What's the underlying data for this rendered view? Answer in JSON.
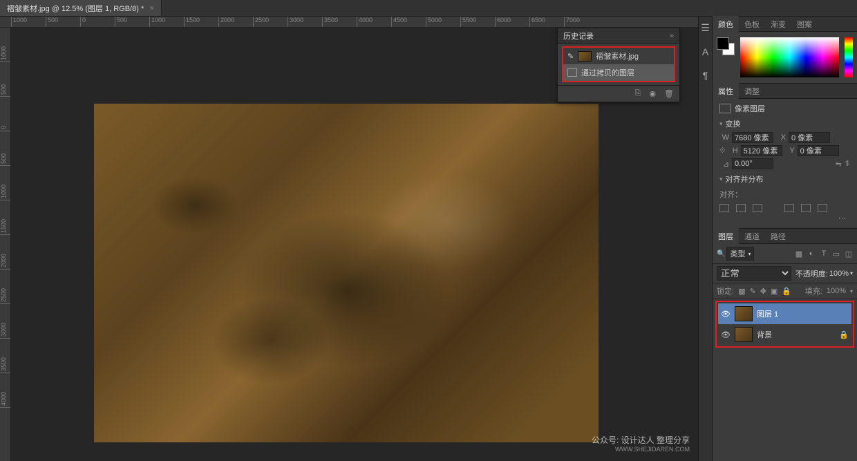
{
  "tab": {
    "title": "褶皱素材.jpg @ 12.5% (图层 1, RGB/8) *"
  },
  "ruler_h": [
    "1000",
    "500",
    "0",
    "500",
    "1000",
    "1500",
    "2000",
    "2500",
    "3000",
    "3500",
    "4000",
    "4500",
    "5000",
    "5500",
    "6000",
    "6500",
    "7000"
  ],
  "ruler_v": [
    "1000",
    "500",
    "0",
    "500",
    "1000",
    "1500",
    "2000",
    "2500",
    "3000",
    "3500",
    "4000"
  ],
  "history": {
    "title": "历史记录",
    "items": [
      {
        "label": "褶皱素材.jpg",
        "type": "open"
      },
      {
        "label": "通过拷贝的图层",
        "type": "action"
      }
    ]
  },
  "color": {
    "tabs": [
      "颜色",
      "色板",
      "渐变",
      "图案"
    ],
    "active": 0
  },
  "properties": {
    "tabs": [
      "属性",
      "调整"
    ],
    "active": 0,
    "kind": "像素图层",
    "transform_hdr": "变换",
    "W": "7680 像素",
    "X": "0 像素",
    "H": "5120 像素",
    "Y": "0 像素",
    "angle": "0.00°",
    "align_hdr": "对齐并分布",
    "align_lbl": "对齐："
  },
  "layers": {
    "tabs": [
      "图层",
      "通道",
      "路径"
    ],
    "active": 0,
    "type_filter": "类型",
    "blend_mode": "正常",
    "opacity_lbl": "不透明度:",
    "opacity_val": "100%",
    "lock_lbl": "锁定:",
    "fill_lbl": "填充:",
    "fill_val": "100%",
    "items": [
      {
        "name": "图层 1",
        "selected": true,
        "locked": false
      },
      {
        "name": "背景",
        "selected": false,
        "locked": true
      }
    ]
  },
  "watermark": {
    "line1": "公众号: 设计达人 整理分享",
    "line2": "WWW.SHEJIDAREN.COM"
  }
}
